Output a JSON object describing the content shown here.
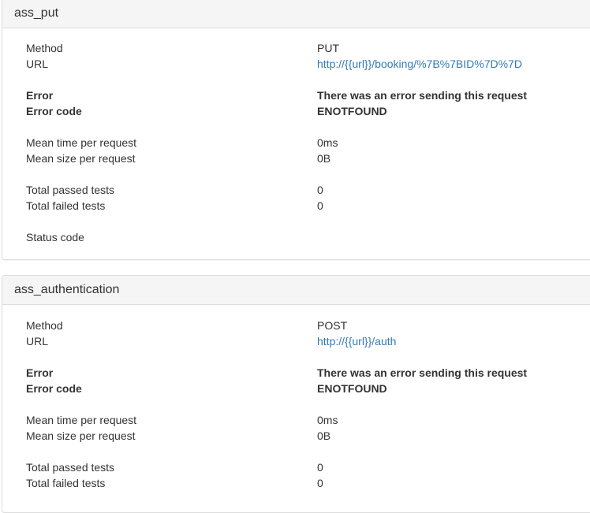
{
  "panels": [
    {
      "title": "ass_put",
      "method_label": "Method",
      "method": "PUT",
      "url_label": "URL",
      "url": "http://{{url}}/booking/%7B%7BID%7D%7D",
      "error_label": "Error",
      "error": "There was an error sending this request",
      "error_code_label": "Error code",
      "error_code": "ENOTFOUND",
      "mean_time_label": "Mean time per request",
      "mean_time": "0ms",
      "mean_size_label": "Mean size per request",
      "mean_size": "0B",
      "passed_label": "Total passed tests",
      "passed": "0",
      "failed_label": "Total failed tests",
      "failed": "0",
      "status_label": "Status code",
      "status": ""
    },
    {
      "title": "ass_authentication",
      "method_label": "Method",
      "method": "POST",
      "url_label": "URL",
      "url": "http://{{url}}/auth",
      "error_label": "Error",
      "error": "There was an error sending this request",
      "error_code_label": "Error code",
      "error_code": "ENOTFOUND",
      "mean_time_label": "Mean time per request",
      "mean_time": "0ms",
      "mean_size_label": "Mean size per request",
      "mean_size": "0B",
      "passed_label": "Total passed tests",
      "passed": "0",
      "failed_label": "Total failed tests",
      "failed": "0"
    }
  ],
  "colors": {
    "link": "#337ab7",
    "heading_bg": "#f5f5f5",
    "border": "#dddddd"
  }
}
